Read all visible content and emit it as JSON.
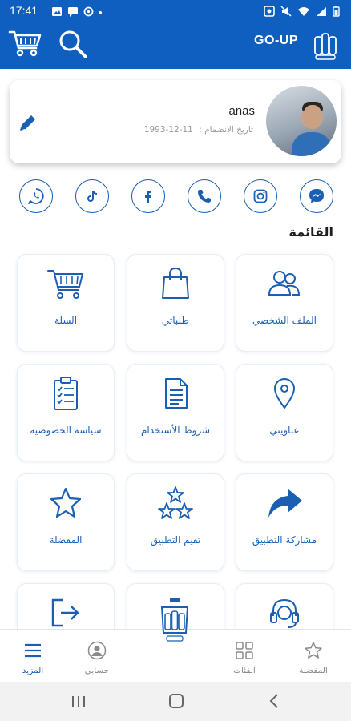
{
  "status_bar": {
    "time": "17:41"
  },
  "app_bar": {
    "brand": "GO-UP",
    "colors": {
      "primary": "#0f5fc0",
      "accent": "#1a5fb4"
    }
  },
  "profile": {
    "name": "anas",
    "join_label": "تاريخ الانضمام :",
    "join_date": "1993-12-11",
    "edit_icon": "pencil-icon"
  },
  "social": [
    "messenger-icon",
    "instagram-icon",
    "phone-icon",
    "facebook-icon",
    "tiktok-icon",
    "whatsapp-icon"
  ],
  "menu_title": "القائمة",
  "menu": [
    {
      "label": "الملف الشخصي",
      "icon": "users-icon"
    },
    {
      "label": "طلباتي",
      "icon": "shopping-bag-icon"
    },
    {
      "label": "السلة",
      "icon": "cart-icon"
    },
    {
      "label": "عناويني",
      "icon": "location-pin-icon"
    },
    {
      "label": "شروط الأستخدام",
      "icon": "document-icon"
    },
    {
      "label": "سياسة الخصوصية",
      "icon": "clipboard-checklist-icon"
    },
    {
      "label": "مشاركة التطبيق",
      "icon": "share-arrow-icon"
    },
    {
      "label": "تقيم التطبيق",
      "icon": "three-stars-icon"
    },
    {
      "label": "المفضلة",
      "icon": "star-icon"
    }
  ],
  "bottom_nav": [
    {
      "label": "المفضلة",
      "icon": "star-icon"
    },
    {
      "label": "الفئات",
      "icon": "grid-icon"
    },
    {
      "label": "حسابي",
      "icon": "account-icon"
    },
    {
      "label": "المزيد",
      "icon": "menu-icon",
      "active": true
    }
  ]
}
